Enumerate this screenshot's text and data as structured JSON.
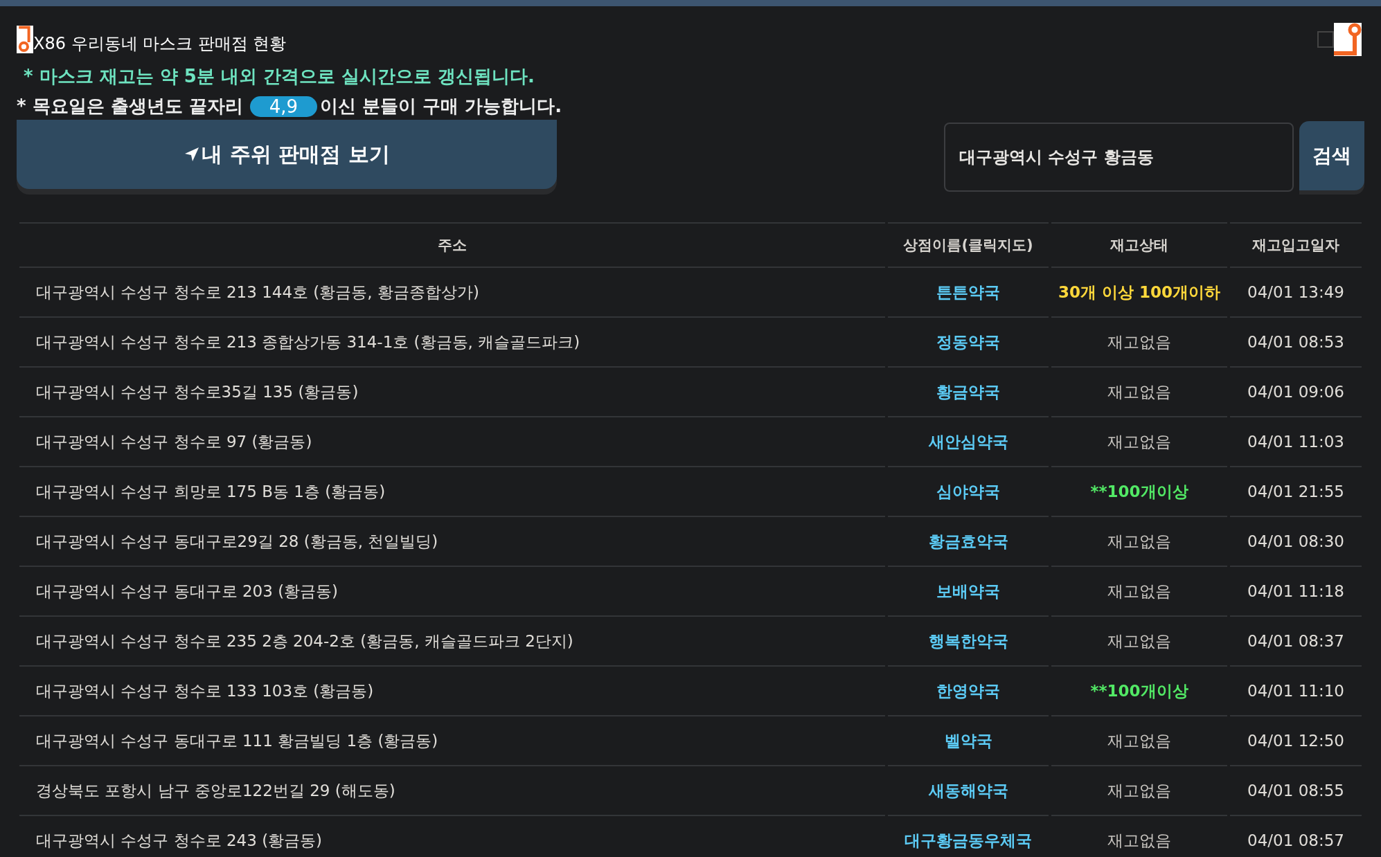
{
  "header": {
    "title": "X86 우리동네 마스크 판매점 현황"
  },
  "notices": {
    "refresh": "* 마스크 재고는 약 5분 내외 간격으로 실시간으로 갱신됩니다.",
    "birth_before": "* 목요일은 출생년도 끝자리",
    "birth_badge": "4,9",
    "birth_after": "이신 분들이 구매 가능합니다."
  },
  "nearby_button": {
    "label": "내 주위 판매점 보기"
  },
  "search": {
    "value": "대구광역시 수성구 황금동",
    "button": "검색"
  },
  "table": {
    "columns": [
      "주소",
      "상점이름(클릭지도)",
      "재고상태",
      "재고입고일자"
    ],
    "rows": [
      {
        "address": "대구광역시 수성구 청수로 213 144호 (황금동, 황금종합상가)",
        "store": "튼튼약국",
        "stock": "30개 이상 100개이하",
        "kind": "some",
        "date": "04/01 13:49"
      },
      {
        "address": "대구광역시 수성구 청수로 213 종합상가동 314-1호 (황금동, 캐슬골드파크)",
        "store": "정동약국",
        "stock": "재고없음",
        "kind": "empty",
        "date": "04/01 08:53"
      },
      {
        "address": "대구광역시 수성구 청수로35길 135 (황금동)",
        "store": "황금약국",
        "stock": "재고없음",
        "kind": "empty",
        "date": "04/01 09:06"
      },
      {
        "address": "대구광역시 수성구 청수로 97 (황금동)",
        "store": "새안심약국",
        "stock": "재고없음",
        "kind": "empty",
        "date": "04/01 11:03"
      },
      {
        "address": "대구광역시 수성구 희망로 175 B동 1층 (황금동)",
        "store": "심야약국",
        "stock": "**100개이상",
        "kind": "plenty",
        "date": "04/01 21:55"
      },
      {
        "address": "대구광역시 수성구 동대구로29길 28 (황금동, 천일빌딩)",
        "store": "황금효약국",
        "stock": "재고없음",
        "kind": "empty",
        "date": "04/01 08:30"
      },
      {
        "address": "대구광역시 수성구 동대구로 203 (황금동)",
        "store": "보배약국",
        "stock": "재고없음",
        "kind": "empty",
        "date": "04/01 11:18"
      },
      {
        "address": "대구광역시 수성구 청수로 235 2층 204-2호 (황금동, 캐슬골드파크 2단지)",
        "store": "행복한약국",
        "stock": "재고없음",
        "kind": "empty",
        "date": "04/01 08:37"
      },
      {
        "address": "대구광역시 수성구 청수로 133 103호 (황금동)",
        "store": "한영약국",
        "stock": "**100개이상",
        "kind": "plenty",
        "date": "04/01 11:10"
      },
      {
        "address": "대구광역시 수성구 동대구로 111 황금빌딩 1층 (황금동)",
        "store": "벨약국",
        "stock": "재고없음",
        "kind": "empty",
        "date": "04/01 12:50"
      },
      {
        "address": "경상북도 포항시 남구 중앙로122번길 29 (해도동)",
        "store": "새동해약국",
        "stock": "재고없음",
        "kind": "empty",
        "date": "04/01 08:55"
      },
      {
        "address": "대구광역시 수성구 청수로 243 (황금동)",
        "store": "대구황금동우체국",
        "stock": "재고없음",
        "kind": "empty",
        "date": "04/01 08:57"
      }
    ]
  }
}
